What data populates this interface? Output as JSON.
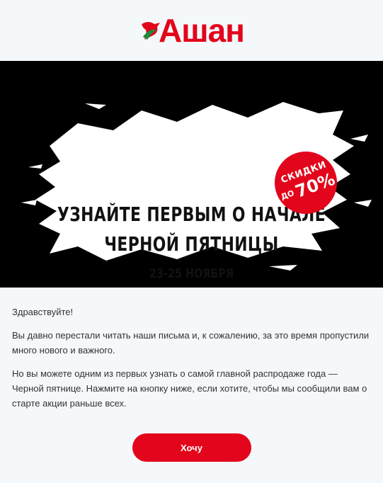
{
  "brand": {
    "name": "Ашан",
    "color": "#e3051b"
  },
  "banner": {
    "title_line1": "УЗНАЙТЕ ПЕРВЫМ О НАЧАЛЕ",
    "title_line2": "ЧЕРНОЙ ПЯТНИЦЫ",
    "dates": "23-25 НОЯБРЯ",
    "badge_top": "СКИДКИ",
    "badge_prefix": "ДО",
    "badge_value": "70%"
  },
  "email": {
    "greeting": "Здравствуйте!",
    "paragraph1": "Вы давно перестали читать наши письма и, к сожалению, за это время пропустили много нового и важного.",
    "paragraph2": "Но вы можете одним из первых узнать о самой главной распродаже года — Черной пятнице. Нажмите на кнопку ниже, если хотите, чтобы мы сообщили вам о старте акции раньше всех."
  },
  "cta": {
    "label": "Хочу"
  }
}
